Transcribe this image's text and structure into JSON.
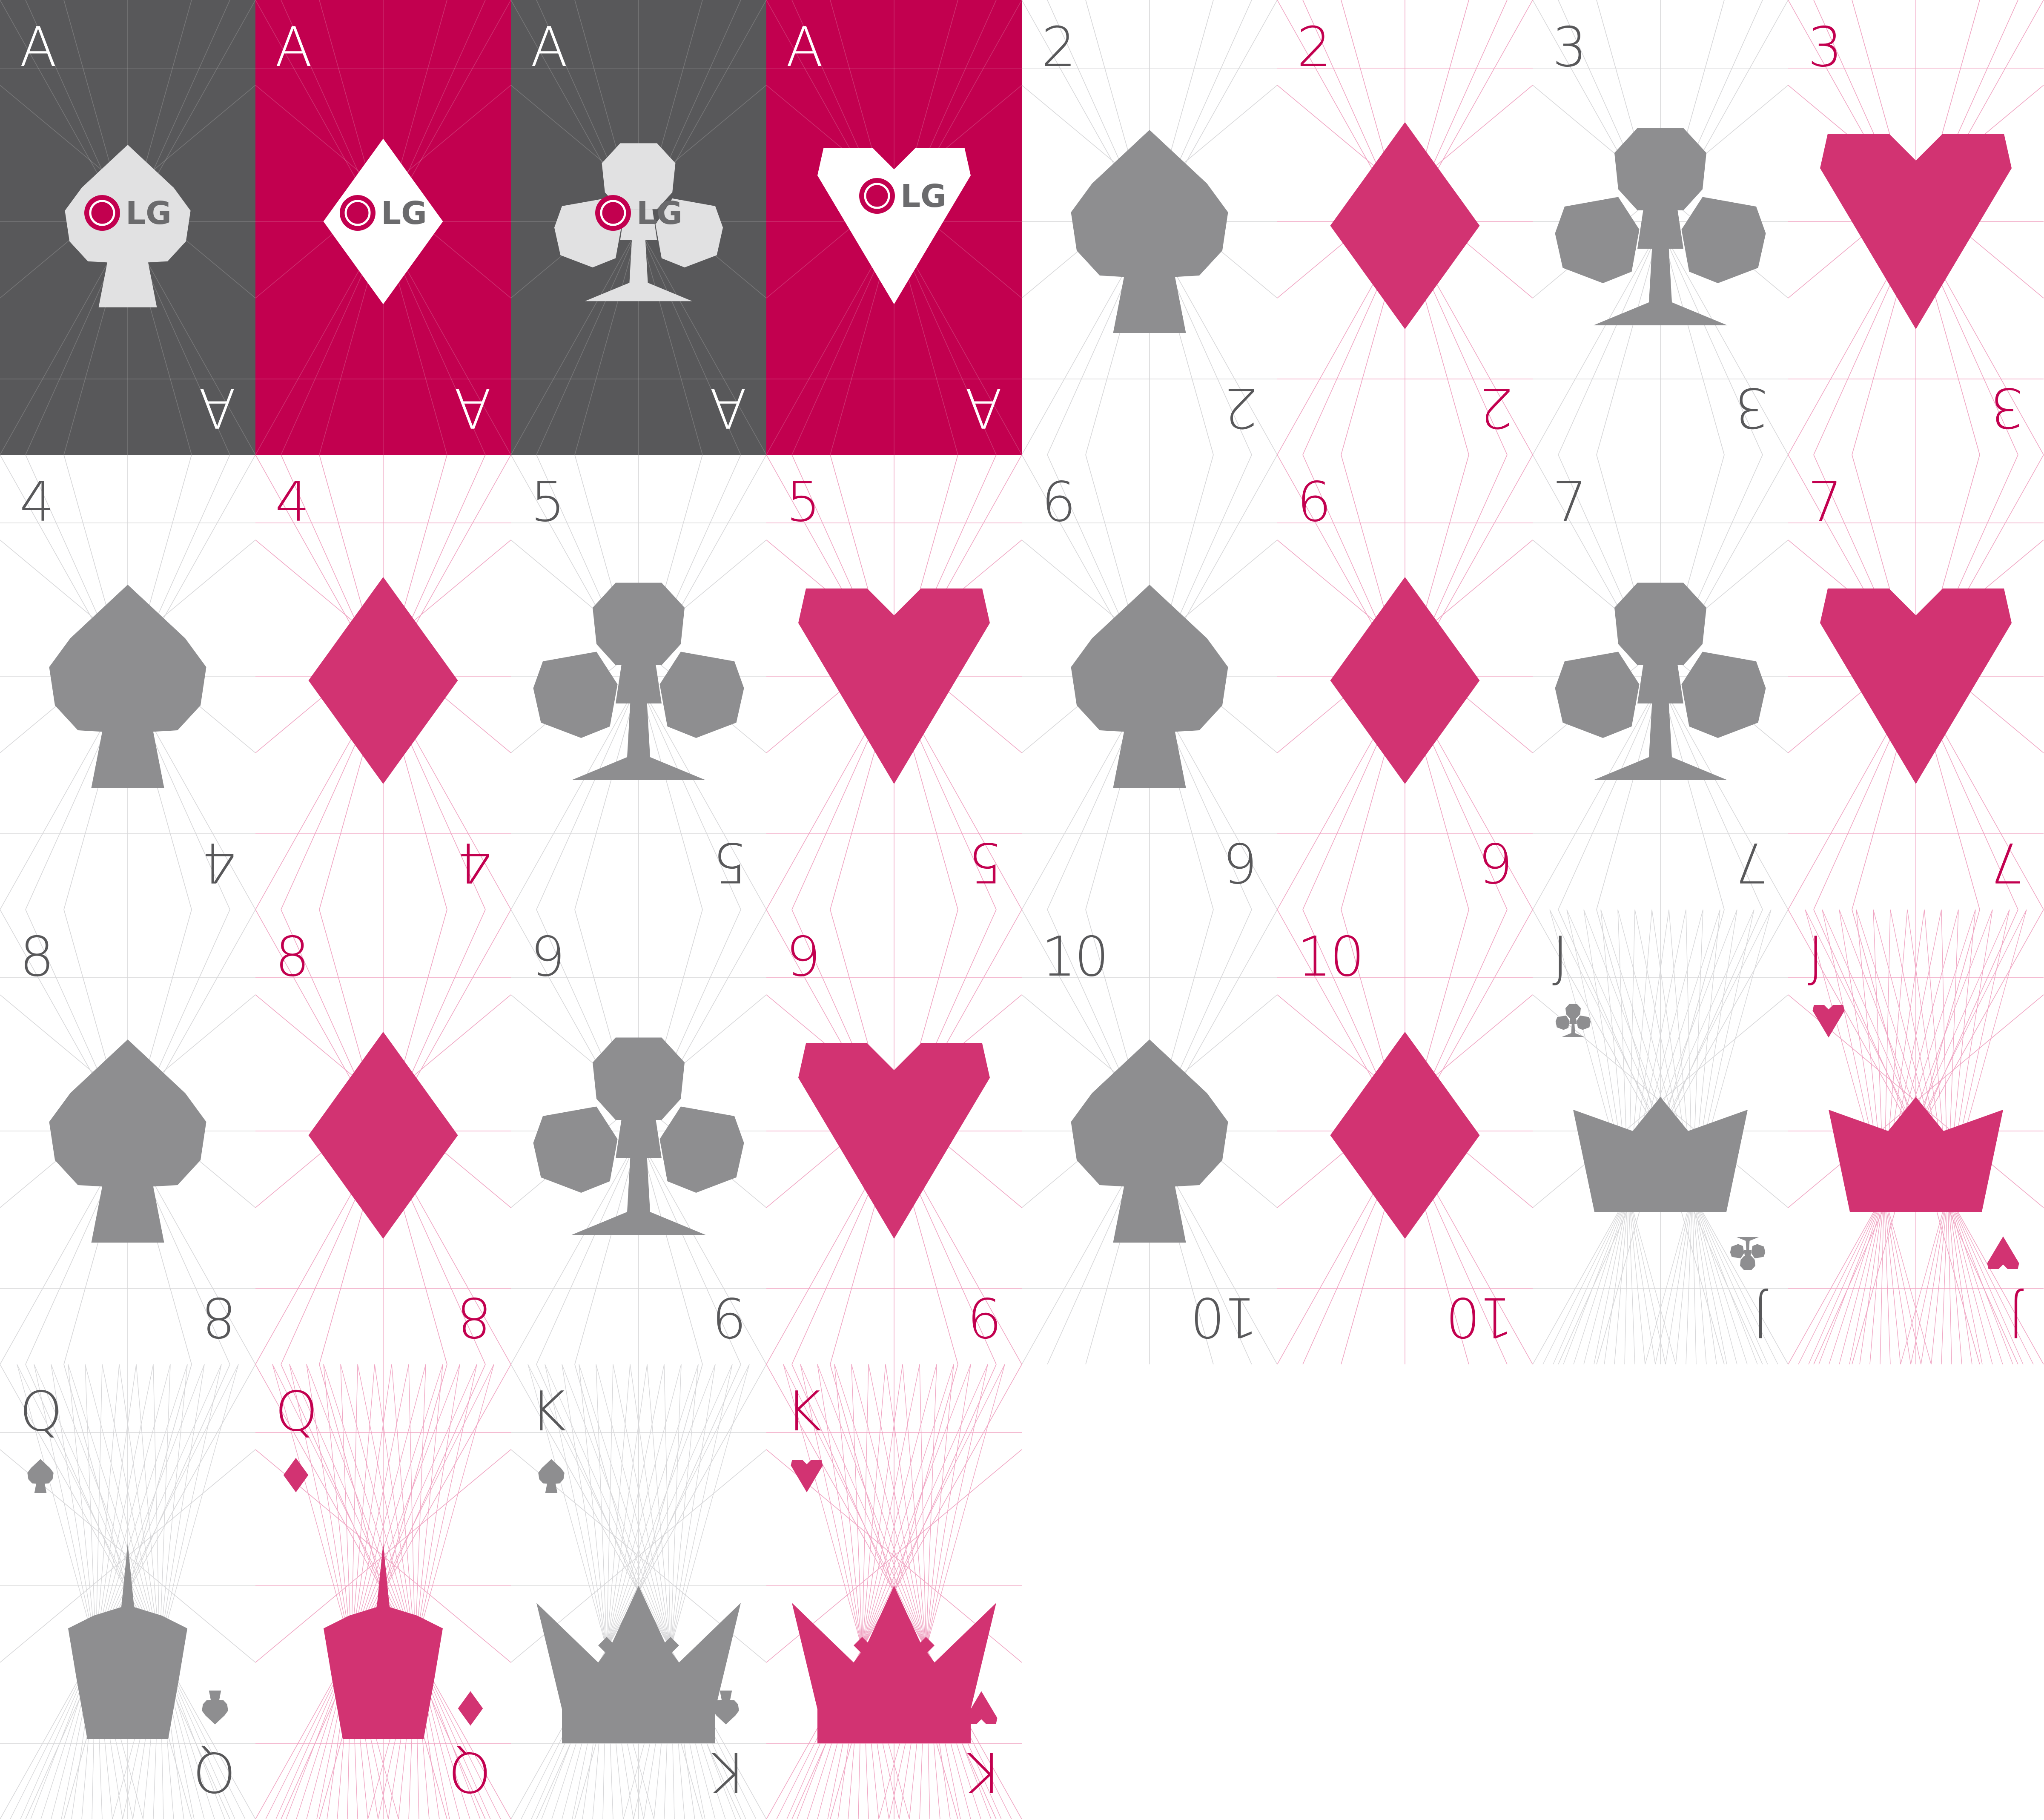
{
  "colors": {
    "dark": "#58585a",
    "brand": "#c2004f",
    "grey_suit": "#8e8e90",
    "pink_suit": "#d23372",
    "ace_shape": "#e1e1e2",
    "guide_grey": "#d7d7d9",
    "guide_pink": "#f0a5c3",
    "logo_red": "#c2004f",
    "logo_text": "#6b6b6d"
  },
  "logo_text": "LG",
  "cards": [
    {
      "rank": "A",
      "suit": "spade",
      "tone": "dark",
      "kind": "ace"
    },
    {
      "rank": "A",
      "suit": "diamond",
      "tone": "brand",
      "kind": "ace"
    },
    {
      "rank": "A",
      "suit": "club",
      "tone": "dark",
      "kind": "ace"
    },
    {
      "rank": "A",
      "suit": "heart",
      "tone": "brand",
      "kind": "ace"
    },
    {
      "rank": "2",
      "suit": "spade",
      "tone": "grey",
      "kind": "number"
    },
    {
      "rank": "2",
      "suit": "diamond",
      "tone": "pink",
      "kind": "number"
    },
    {
      "rank": "3",
      "suit": "club",
      "tone": "grey",
      "kind": "number"
    },
    {
      "rank": "3",
      "suit": "heart",
      "tone": "pink",
      "kind": "number"
    },
    {
      "rank": "4",
      "suit": "spade",
      "tone": "grey",
      "kind": "number"
    },
    {
      "rank": "4",
      "suit": "diamond",
      "tone": "pink",
      "kind": "number"
    },
    {
      "rank": "5",
      "suit": "club",
      "tone": "grey",
      "kind": "number"
    },
    {
      "rank": "5",
      "suit": "heart",
      "tone": "pink",
      "kind": "number"
    },
    {
      "rank": "6",
      "suit": "spade",
      "tone": "grey",
      "kind": "number"
    },
    {
      "rank": "6",
      "suit": "diamond",
      "tone": "pink",
      "kind": "number"
    },
    {
      "rank": "7",
      "suit": "club",
      "tone": "grey",
      "kind": "number"
    },
    {
      "rank": "7",
      "suit": "heart",
      "tone": "pink",
      "kind": "number"
    },
    {
      "rank": "8",
      "suit": "spade",
      "tone": "grey",
      "kind": "number"
    },
    {
      "rank": "8",
      "suit": "diamond",
      "tone": "pink",
      "kind": "number"
    },
    {
      "rank": "9",
      "suit": "club",
      "tone": "grey",
      "kind": "number"
    },
    {
      "rank": "9",
      "suit": "heart",
      "tone": "pink",
      "kind": "number"
    },
    {
      "rank": "10",
      "suit": "spade",
      "tone": "grey",
      "kind": "number"
    },
    {
      "rank": "10",
      "suit": "diamond",
      "tone": "pink",
      "kind": "number"
    },
    {
      "rank": "J",
      "suit": "club",
      "tone": "grey",
      "kind": "jack"
    },
    {
      "rank": "J",
      "suit": "heart",
      "tone": "pink",
      "kind": "jack"
    },
    {
      "rank": "Q",
      "suit": "spade",
      "tone": "grey",
      "kind": "queen"
    },
    {
      "rank": "Q",
      "suit": "diamond",
      "tone": "pink",
      "kind": "queen"
    },
    {
      "rank": "K",
      "suit": "spade",
      "tone": "grey",
      "kind": "king"
    },
    {
      "rank": "K",
      "suit": "heart",
      "tone": "pink",
      "kind": "king"
    }
  ]
}
